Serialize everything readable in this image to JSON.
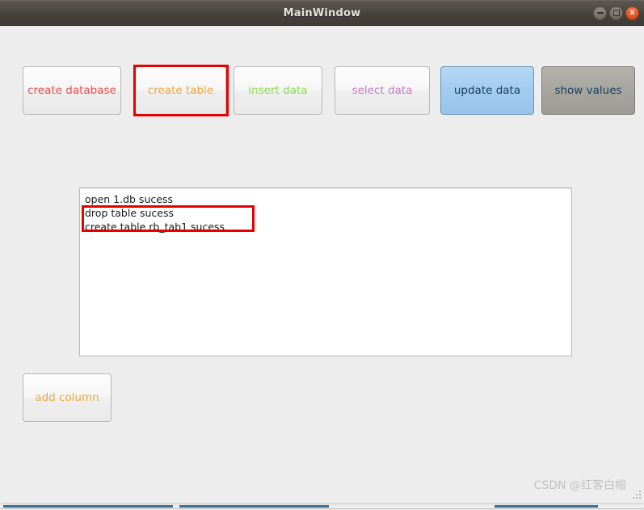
{
  "window": {
    "title": "MainWindow",
    "controls": [
      {
        "name": "minimize",
        "label": "–"
      },
      {
        "name": "maximize",
        "label": "□"
      },
      {
        "name": "close",
        "label": "x"
      }
    ]
  },
  "toolbar": {
    "buttons": [
      {
        "name": "create-database",
        "label": "create database",
        "text_color": "#ef4b4b",
        "bg": "#f6f6f6"
      },
      {
        "name": "create-table",
        "label": "create table",
        "text_color": "#f0a73c",
        "bg": "#f6f6f6",
        "annotated": true
      },
      {
        "name": "insert-data",
        "label": "insert data",
        "text_color": "#8ade4a",
        "bg": "#f6f6f6"
      },
      {
        "name": "select-data",
        "label": "select data",
        "text_color": "#c77cc0",
        "bg": "#f6f6f6"
      },
      {
        "name": "update-data",
        "label": "update data",
        "text_color": "#1b3d66",
        "bg": "#a2cbf0"
      },
      {
        "name": "show-values",
        "label": "show values",
        "text_color": "#1b3d66",
        "bg": "#a6a69e"
      }
    ]
  },
  "log": {
    "lines": [
      "open 1.db sucess",
      "drop table sucess",
      "create table rb_tab1 sucess"
    ]
  },
  "actions": {
    "add_column_label": "add column",
    "add_column_color": "#f0a73c"
  },
  "annotations": {
    "color": "#e60000",
    "items": [
      {
        "name": "create-table-button-highlight",
        "target": "create table"
      },
      {
        "name": "log-lines-highlight",
        "target": "drop table sucess / create table rb_tab1 sucess"
      }
    ]
  },
  "watermark": {
    "text": "CSDN @红客白帽"
  }
}
